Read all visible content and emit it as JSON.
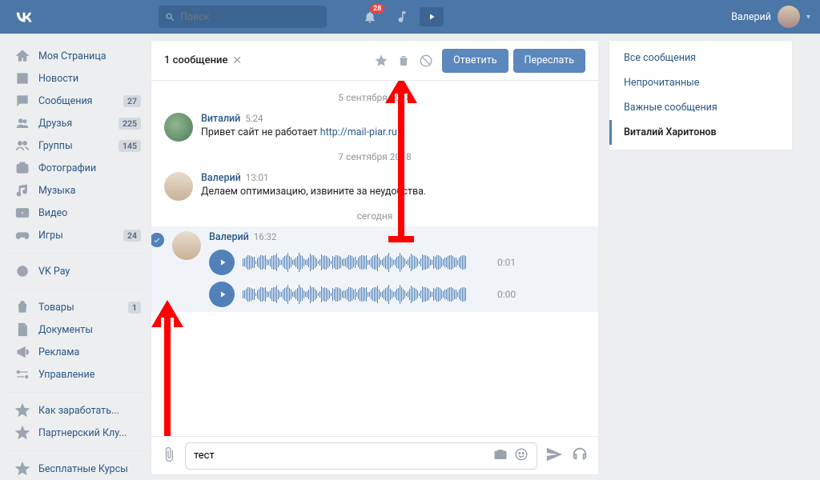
{
  "header": {
    "search_placeholder": "Поиск",
    "notification_badge": "28",
    "user_name": "Валерий"
  },
  "sidebar": {
    "items": [
      {
        "icon": "home",
        "label": "Моя Страница",
        "count": null
      },
      {
        "icon": "news",
        "label": "Новости",
        "count": null
      },
      {
        "icon": "msg",
        "label": "Сообщения",
        "count": "27"
      },
      {
        "icon": "friends",
        "label": "Друзья",
        "count": "225"
      },
      {
        "icon": "groups",
        "label": "Группы",
        "count": "145"
      },
      {
        "icon": "photo",
        "label": "Фотографии",
        "count": null
      },
      {
        "icon": "music",
        "label": "Музыка",
        "count": null
      },
      {
        "icon": "video",
        "label": "Видео",
        "count": null
      },
      {
        "icon": "games",
        "label": "Игры",
        "count": "24"
      }
    ],
    "pay_label": "VK Pay",
    "items2": [
      {
        "icon": "goods",
        "label": "Товары",
        "count": "1"
      },
      {
        "icon": "docs",
        "label": "Документы",
        "count": null
      },
      {
        "icon": "ads",
        "label": "Реклама",
        "count": null
      },
      {
        "icon": "manage",
        "label": "Управление",
        "count": null
      }
    ],
    "items3": [
      {
        "label": "Как заработать..."
      },
      {
        "label": "Партнерский Клу..."
      }
    ],
    "items4": [
      {
        "label": "Бесплатные Курсы"
      }
    ]
  },
  "msgbar": {
    "title": "1 сообщение",
    "reply": "Ответить",
    "forward": "Переслать"
  },
  "conversation": {
    "date1": "5 сентября 2018",
    "msg1": {
      "name": "Виталий",
      "time": "5:24",
      "text": "Привет сайт не работает ",
      "link": "http://mail-piar.ru"
    },
    "date2": "7 сентября 2018",
    "msg2": {
      "name": "Валерий",
      "time": "13:01",
      "text": "Делаем оптимизацию, извините за неудобства."
    },
    "date3": "сегодня",
    "msg3": {
      "name": "Валерий",
      "time": "16:32"
    },
    "audio1_dur": "0:01",
    "audio2_dur": "0:00"
  },
  "input": {
    "value": "тест"
  },
  "rpanel": {
    "items": [
      {
        "label": "Все сообщения",
        "active": false
      },
      {
        "label": "Непрочитанные",
        "active": false
      },
      {
        "label": "Важные сообщения",
        "active": false
      },
      {
        "label": "Виталий Харитонов",
        "active": true
      }
    ]
  }
}
